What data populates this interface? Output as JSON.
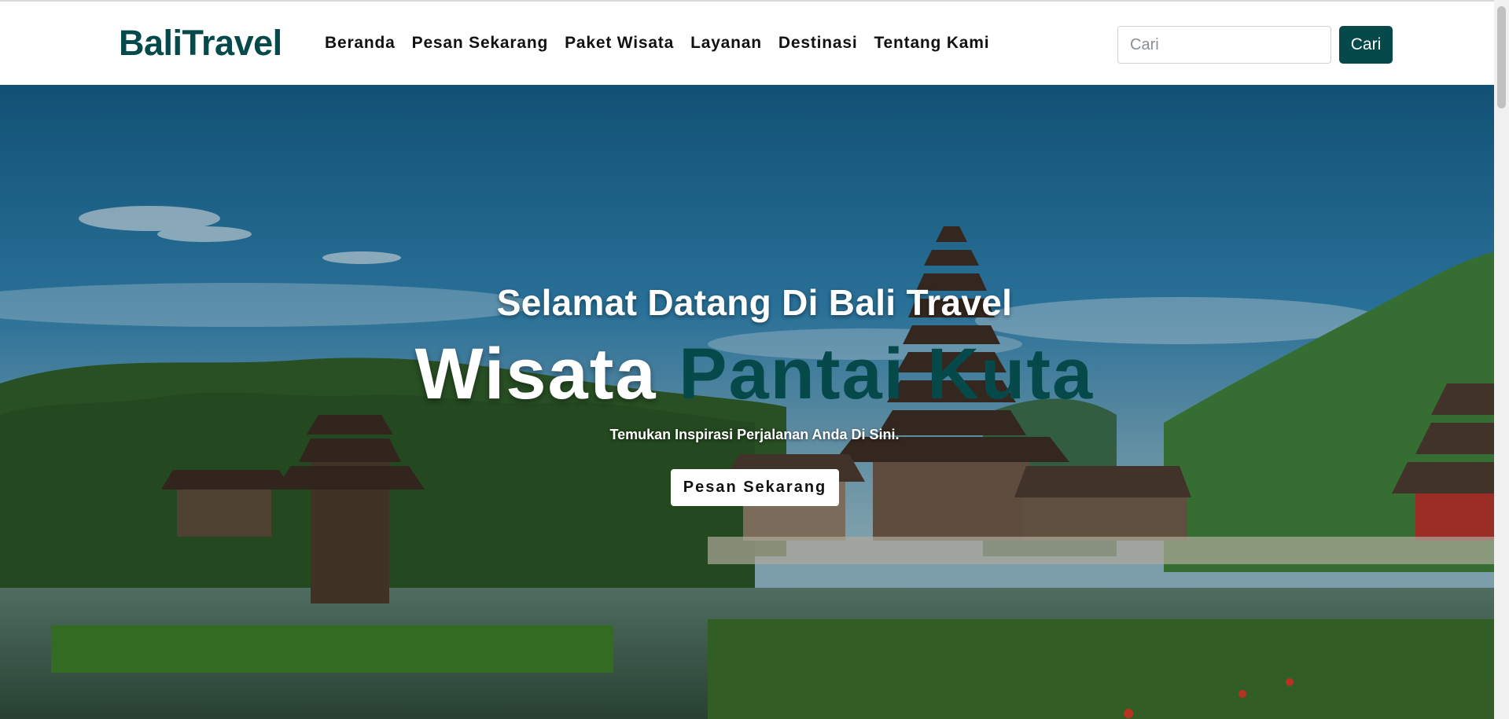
{
  "brand": {
    "part1": "Bali",
    "part2": "Travel"
  },
  "nav": {
    "items": [
      {
        "label": "Beranda"
      },
      {
        "label": "Pesan Sekarang"
      },
      {
        "label": "Paket Wisata"
      },
      {
        "label": "Layanan"
      },
      {
        "label": "Destinasi"
      },
      {
        "label": "Tentang Kami"
      }
    ]
  },
  "search": {
    "placeholder": "Cari",
    "value": "",
    "button_label": "Cari"
  },
  "hero": {
    "welcome": "Selamat Datang Di Bali Travel",
    "title_part1": "Wisata",
    "title_part2": "Pantai Kuta",
    "tagline": "Temukan Inspirasi Perjalanan Anda Di Sini.",
    "cta_label": "Pesan Sekarang",
    "background_image": "bali-temple-lake-photo"
  },
  "colors": {
    "brand": "#06494a",
    "button_bg": "#06494a",
    "cta_bg": "#ffffff"
  }
}
